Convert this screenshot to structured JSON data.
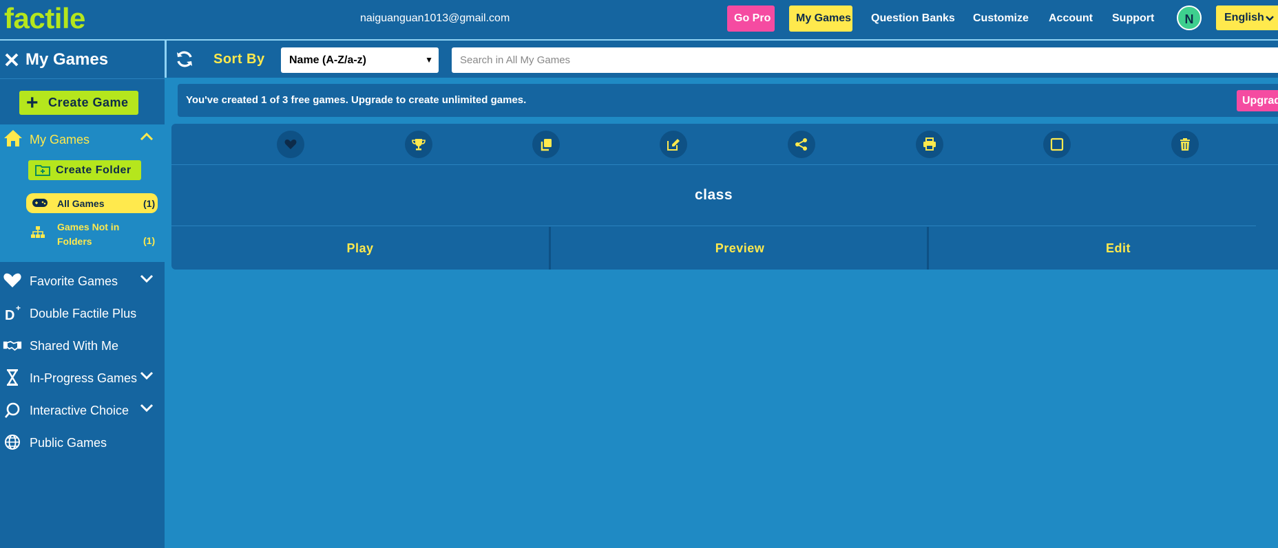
{
  "header": {
    "logo": "factile",
    "email": "naiguanguan1013@gmail.com",
    "nav": {
      "go_pro": "Go Pro",
      "my_games": "My Games",
      "question_banks": "Question Banks",
      "customize": "Customize",
      "account": "Account",
      "support": "Support"
    },
    "avatar_initial": "N",
    "language": "English"
  },
  "sidebar": {
    "title": "My Games",
    "create_game": "Create Game",
    "my_games": {
      "label": "My Games",
      "create_folder": "Create Folder",
      "all_games": {
        "label": "All Games",
        "count": "(1)"
      },
      "not_in_folders": {
        "label": "Games Not in Folders",
        "count": "(1)"
      }
    },
    "items": [
      {
        "label": "Favorite Games",
        "icon": "heart-icon"
      },
      {
        "label": "Double Factile Plus",
        "icon": "double-factile-plus-icon"
      },
      {
        "label": "Shared With Me",
        "icon": "handshake-icon"
      },
      {
        "label": "In-Progress Games",
        "icon": "hourglass-icon"
      },
      {
        "label": "Interactive Choice",
        "icon": "interactive-choice-icon"
      },
      {
        "label": "Public Games",
        "icon": "globe-icon"
      }
    ]
  },
  "toolbar": {
    "sort_by_label": "Sort By",
    "sort_value": "Name (A-Z/a-z)",
    "search_placeholder": "Search in All My Games"
  },
  "banner": {
    "text": "You've created 1 of 3 free games. Upgrade to create unlimited games.",
    "upgrade_button": "Upgrade"
  },
  "game_card": {
    "title": "class",
    "actions": {
      "play": "Play",
      "preview": "Preview",
      "edit": "Edit"
    },
    "icons": [
      "heart-icon",
      "trophy-icon",
      "copy-icon",
      "edit-icon",
      "share-icon",
      "print-icon",
      "checkbox-icon",
      "trash-icon"
    ]
  },
  "colors": {
    "background": "#1f8ac4",
    "panel": "#1565a0",
    "accent_yellow": "#ffe94d",
    "accent_green": "#b5e61d",
    "accent_pink": "#f54ba1"
  }
}
